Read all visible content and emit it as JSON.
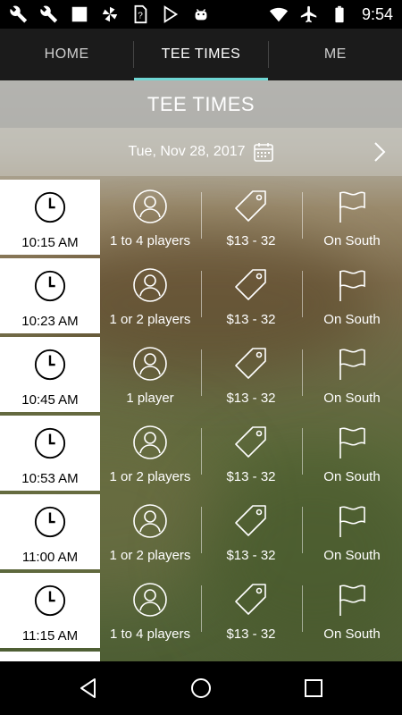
{
  "status_bar": {
    "time": "9:54",
    "left_icons": [
      "wrench-icon",
      "wrench-icon",
      "stop-square-icon",
      "pinwheel-icon",
      "sim-question-icon",
      "play-store-icon",
      "android-icon"
    ],
    "right_icons": [
      "wifi-icon",
      "airplane-icon",
      "battery-icon"
    ]
  },
  "tabs": [
    {
      "label": "HOME",
      "active": false
    },
    {
      "label": "TEE TIMES",
      "active": true
    },
    {
      "label": "ME",
      "active": false
    }
  ],
  "header": {
    "title": "TEE TIMES",
    "date": "Tue, Nov 28, 2017"
  },
  "tee_times": [
    {
      "time": "10:15 AM",
      "players": "1 to 4 players",
      "price": "$13 - 32",
      "course": "On South"
    },
    {
      "time": "10:23 AM",
      "players": "1 or 2 players",
      "price": "$13 - 32",
      "course": "On South"
    },
    {
      "time": "10:45 AM",
      "players": "1 player",
      "price": "$13 - 32",
      "course": "On South"
    },
    {
      "time": "10:53 AM",
      "players": "1 or 2 players",
      "price": "$13 - 32",
      "course": "On South"
    },
    {
      "time": "11:00 AM",
      "players": "1 or 2 players",
      "price": "$13 - 32",
      "course": "On South"
    },
    {
      "time": "11:15 AM",
      "players": "1 to 4 players",
      "price": "$13 - 32",
      "course": "On South"
    }
  ],
  "colors": {
    "tab_indicator": "#6fd6d3",
    "tab_bar": "#1b1b1b"
  },
  "nav_icons": [
    "back-icon",
    "home-icon",
    "recents-icon"
  ]
}
